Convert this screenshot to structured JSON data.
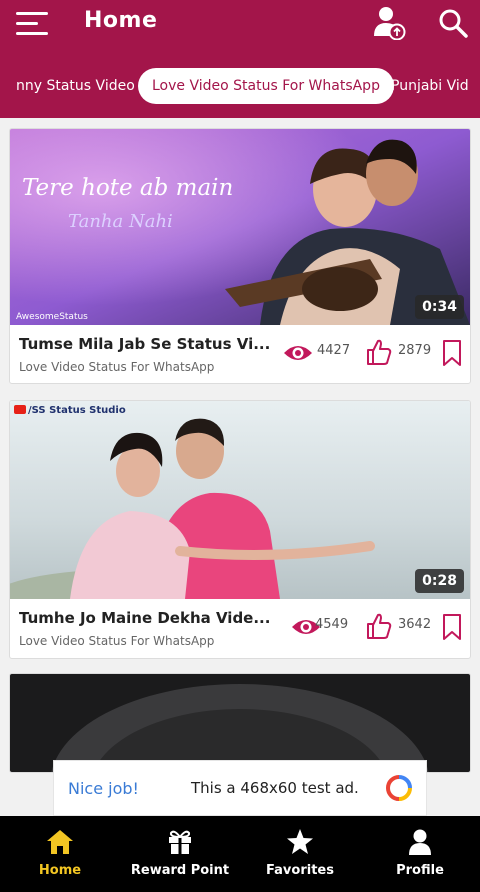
{
  "header": {
    "title": "Home",
    "icons": [
      "menu-icon",
      "user-share-icon",
      "search-icon"
    ]
  },
  "tabs": [
    {
      "label": "nny Status Video",
      "active": false
    },
    {
      "label": "Love Video Status For WhatsApp",
      "active": true
    },
    {
      "label": "Punjabi Vid",
      "active": false
    }
  ],
  "videos": [
    {
      "title": "Tumse Mila Jab Se Status Vi...",
      "category": "Love Video Status For WhatsApp",
      "views": "4427",
      "likes": "2879",
      "duration": "0:34",
      "overlay_line1": "Tere hote ab main",
      "overlay_line2": "Tanha Nahi",
      "watermark": "AwesomeStatus"
    },
    {
      "title": "Tumhe Jo Maine Dekha Vide...",
      "category": "Love Video Status For WhatsApp",
      "views": "4549",
      "likes": "3642",
      "duration": "0:28",
      "watermark": "/SS Status Studio"
    },
    {
      "title": "",
      "category": ""
    }
  ],
  "ad": {
    "label": "Nice job!",
    "text": "This a 468x60 test ad."
  },
  "bottom_nav": [
    {
      "label": "Home",
      "icon": "home-icon",
      "active": true
    },
    {
      "label": "Reward Point",
      "icon": "gift-icon",
      "active": false
    },
    {
      "label": "Favorites",
      "icon": "star-icon",
      "active": false
    },
    {
      "label": "Profile",
      "icon": "person-icon",
      "active": false
    }
  ],
  "colors": {
    "primary": "#a3154a",
    "accent": "#c2185b",
    "nav_active": "#f3c623",
    "nav_bg": "#000000"
  }
}
